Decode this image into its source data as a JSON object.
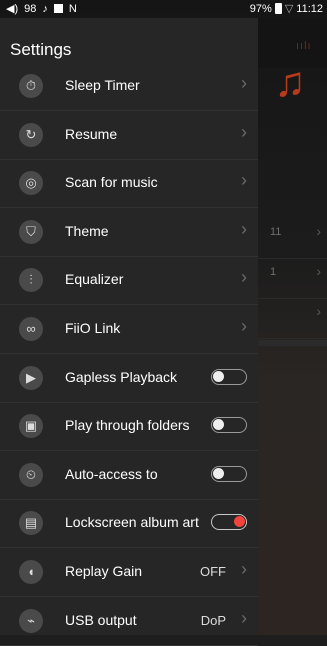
{
  "status_bar": {
    "volume": "98",
    "battery_percent": "97%",
    "time": "11:12"
  },
  "background": {
    "rows": [
      {
        "value": "11"
      },
      {
        "value": "1"
      },
      {
        "value": ""
      }
    ]
  },
  "drawer": {
    "title": "Settings",
    "items": [
      {
        "label": "Sleep Timer",
        "icon": "timer-icon",
        "kind": "chevron"
      },
      {
        "label": "Resume",
        "icon": "resume-icon",
        "kind": "chevron"
      },
      {
        "label": "Scan for music",
        "icon": "scan-icon",
        "kind": "chevron"
      },
      {
        "label": "Theme",
        "icon": "shirt-icon",
        "kind": "chevron"
      },
      {
        "label": "Equalizer",
        "icon": "equalizer-icon",
        "kind": "chevron"
      },
      {
        "label": "FiiO Link",
        "icon": "link-icon",
        "kind": "chevron"
      },
      {
        "label": "Gapless Playback",
        "icon": "play-icon",
        "kind": "toggle",
        "on": false
      },
      {
        "label": "Play through folders",
        "icon": "folder-play-icon",
        "kind": "toggle",
        "on": false
      },
      {
        "label": "Auto-access to",
        "icon": "auto-play-icon",
        "kind": "toggle",
        "on": false
      },
      {
        "label": "Lockscreen album art",
        "icon": "lockscreen-icon",
        "kind": "toggle",
        "on": true
      },
      {
        "label": "Replay Gain",
        "icon": "replay-gain-icon",
        "kind": "value",
        "value": "OFF"
      },
      {
        "label": "USB output",
        "icon": "usb-icon",
        "kind": "value",
        "value": "DoP"
      }
    ]
  },
  "colors": {
    "drawer_bg": "#262626",
    "toggle_on": "#f0443c",
    "accent": "#b63a1c"
  }
}
